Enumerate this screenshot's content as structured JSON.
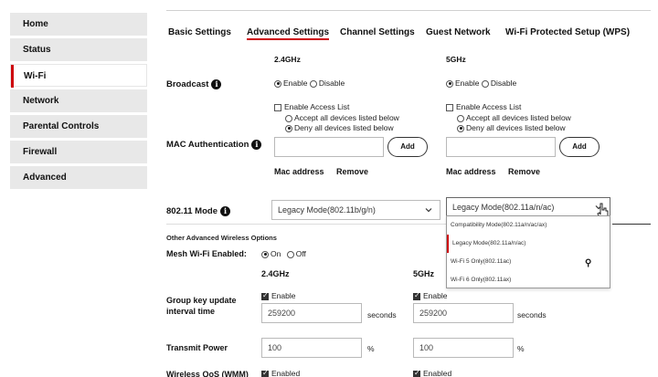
{
  "sidebar": {
    "items": [
      {
        "label": "Home"
      },
      {
        "label": "Status"
      },
      {
        "label": "Wi-Fi"
      },
      {
        "label": "Network"
      },
      {
        "label": "Parental Controls"
      },
      {
        "label": "Firewall"
      },
      {
        "label": "Advanced"
      }
    ],
    "active_index": 2
  },
  "tabs": [
    {
      "label": "Basic Settings"
    },
    {
      "label": "Advanced Settings"
    },
    {
      "label": "Channel Settings"
    },
    {
      "label": "Guest Network"
    },
    {
      "label": "Wi-Fi Protected Setup (WPS)"
    }
  ],
  "bands": {
    "b24": "2.4GHz",
    "b5": "5GHz"
  },
  "broadcast": {
    "label": "Broadcast",
    "enable": "Enable",
    "disable": "Disable"
  },
  "mac_auth": {
    "label": "MAC Authentication",
    "enable_list": "Enable Access List",
    "accept_all": "Accept all devices listed below",
    "deny_all": "Deny all devices listed below",
    "add_label": "Add",
    "col_mac": "Mac address",
    "col_remove": "Remove"
  },
  "mode": {
    "label": "802.11 Mode",
    "value_24": "Legacy Mode(802.11b/g/n)",
    "value_5": "Legacy Mode(802.11a/n/ac)",
    "options_5": [
      "Compatibility Mode(802.11a/n/ac/ax)",
      "Legacy Mode(802.11a/n/ac)",
      "Wi-Fi 5 Only(802.11ac)",
      "Wi-Fi 6 Only(802.11ax)"
    ],
    "selected_option_index": 1
  },
  "other": {
    "heading": "Other Advanced Wireless Options",
    "mesh_label": "Mesh Wi-Fi Enabled:",
    "mesh_on": "On",
    "mesh_off": "Off",
    "band_24": "2.4GHz",
    "band_5": "5GHz"
  },
  "group_key": {
    "label_line1": "Group key update",
    "label_line2": "interval time",
    "enable": "Enable",
    "value_24": "259200",
    "value_5": "259200",
    "unit": "seconds"
  },
  "transmit_power": {
    "label": "Transmit Power",
    "value_24": "100",
    "value_5": "100",
    "unit": "%"
  },
  "wmm": {
    "label": "Wireless QoS (WMM)",
    "enable": "Enabled"
  },
  "colors": {
    "accent": "#cd040b",
    "sidebar_bg": "#e8e8e8"
  }
}
